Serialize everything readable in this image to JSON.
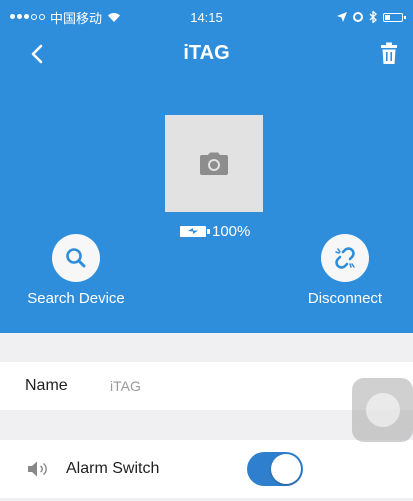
{
  "status_bar": {
    "carrier": "中国移动",
    "time": "14:15"
  },
  "nav": {
    "title": "iTAG",
    "back_icon": "chevron-left-icon",
    "delete_icon": "trash-icon"
  },
  "device": {
    "photo_icon": "camera-icon",
    "battery_percent": "100%",
    "battery_icon": "battery-charging-icon"
  },
  "actions": {
    "search_label": "Search Device",
    "search_icon": "search-icon",
    "disconnect_label": "Disconnect",
    "disconnect_icon": "broken-link-icon"
  },
  "settings": {
    "name_label": "Name",
    "name_value": "iTAG",
    "alarm_label": "Alarm Switch",
    "alarm_on": true,
    "alarm_icon": "speaker-icon"
  },
  "colors": {
    "primary": "#2f8edb",
    "toggle_on": "#2f7fcf",
    "background": "#f0f0f2"
  }
}
